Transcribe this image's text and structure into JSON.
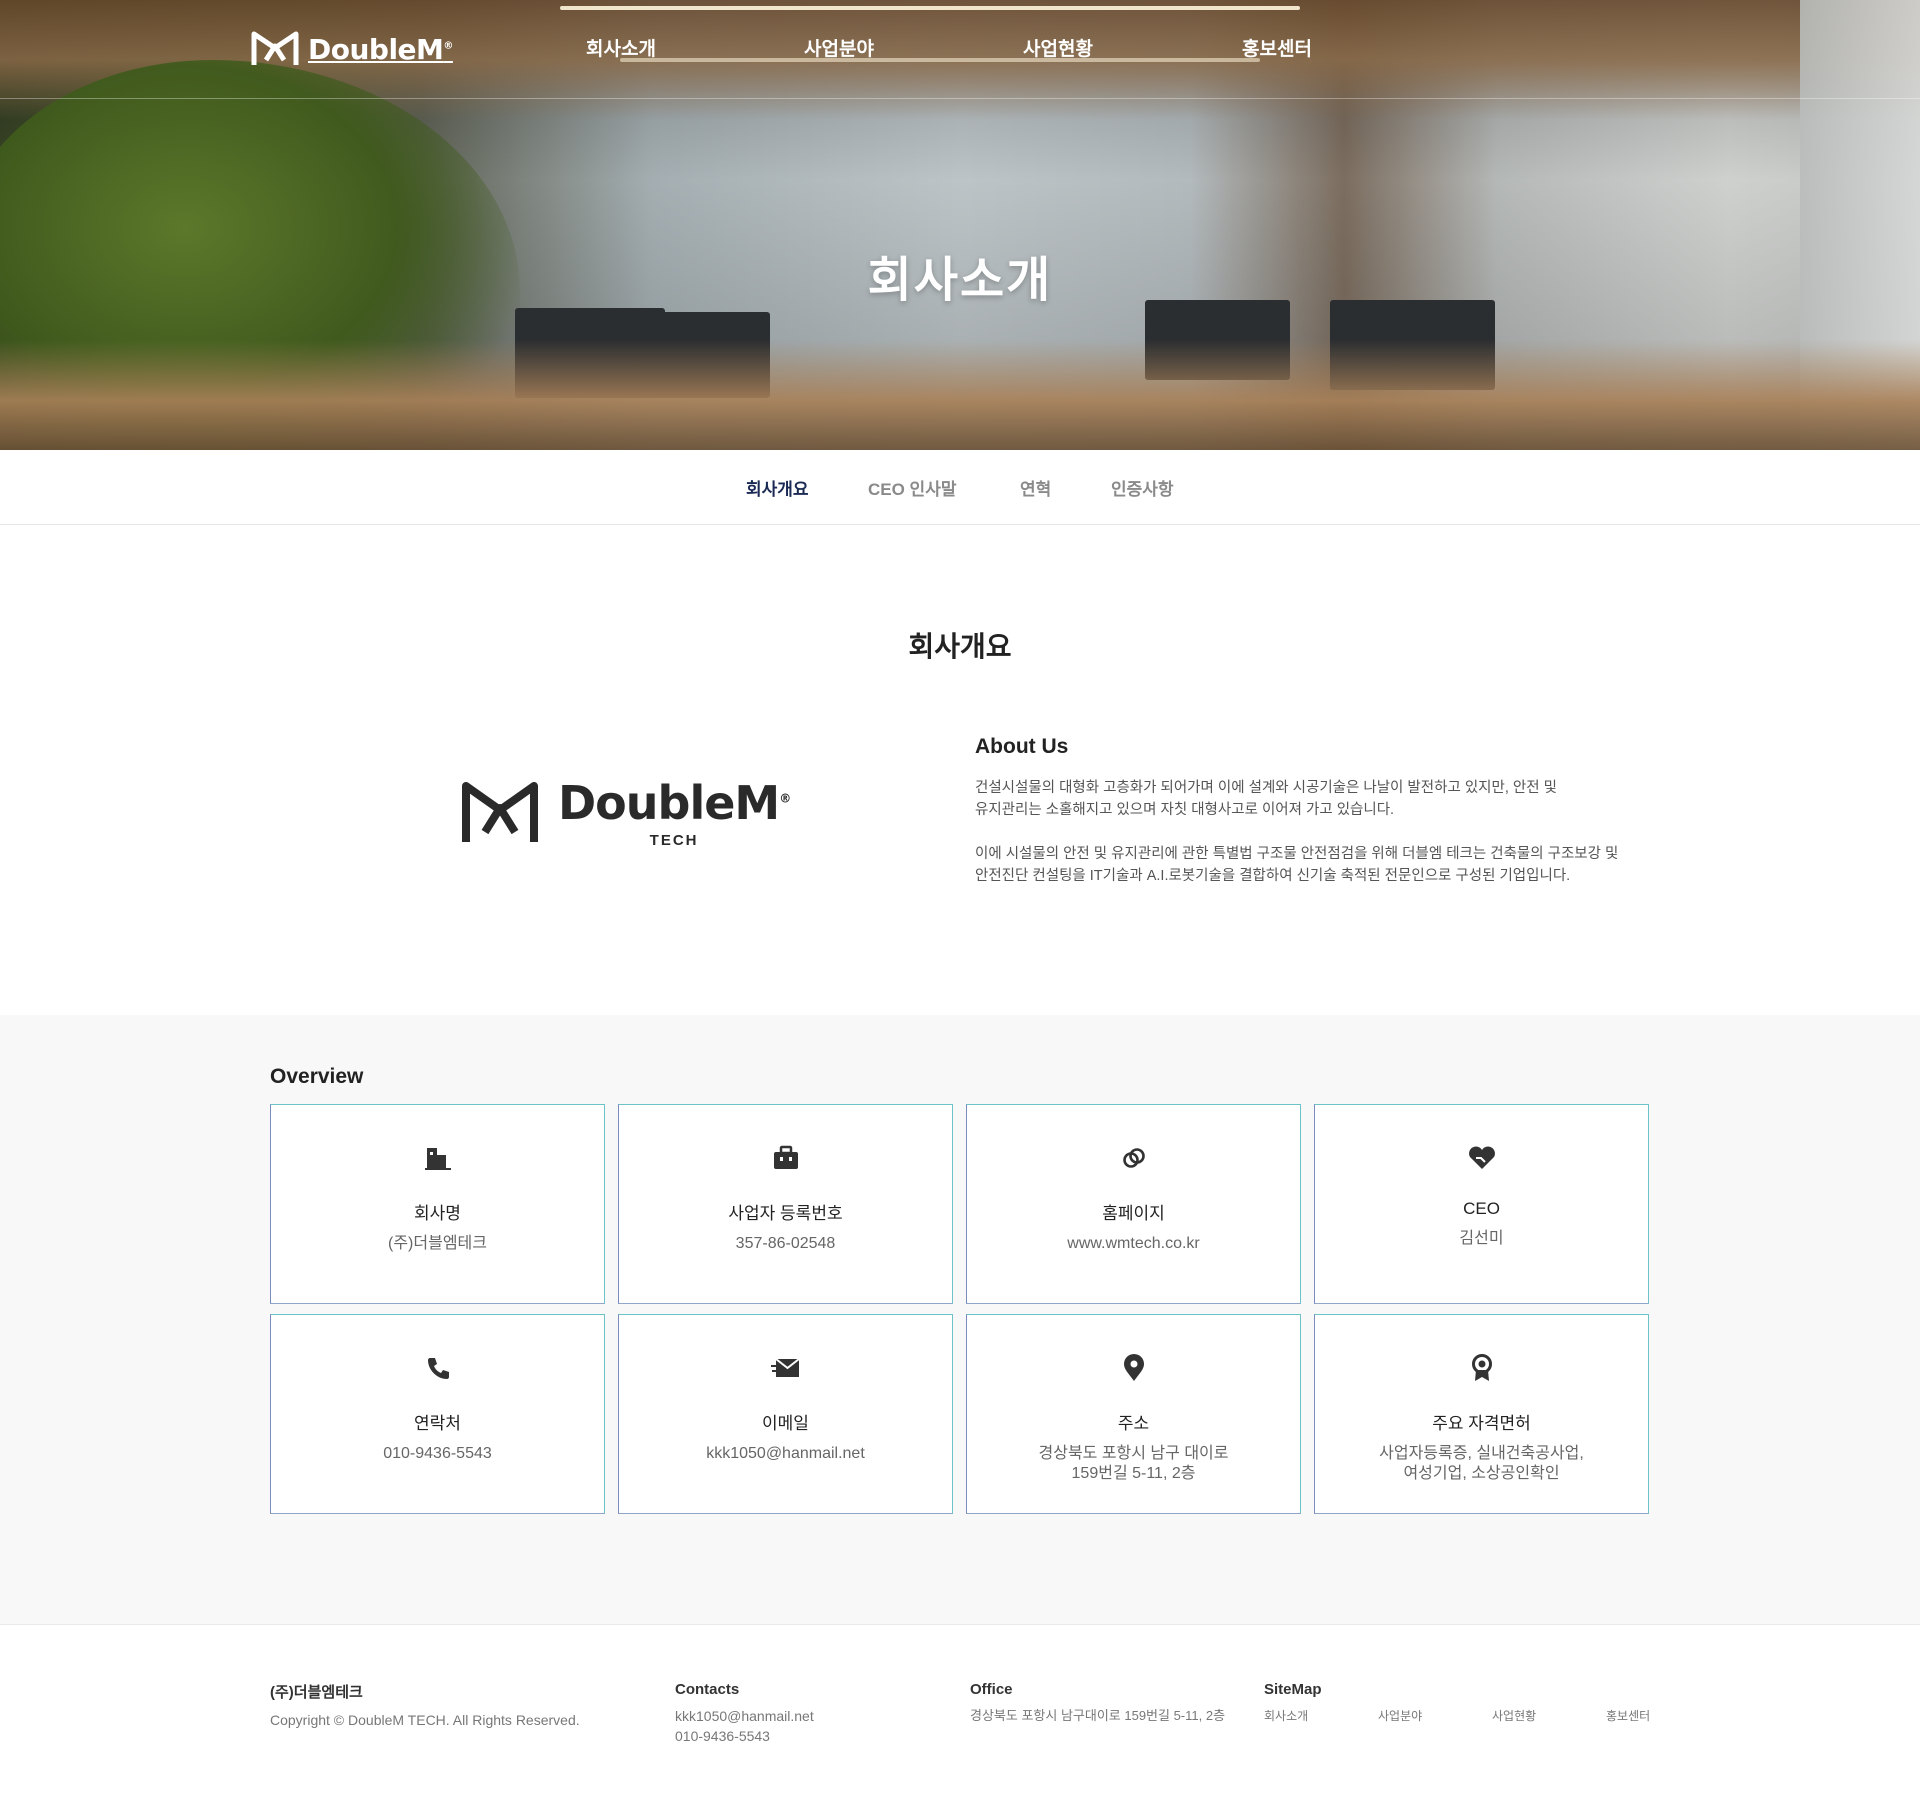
{
  "header": {
    "logo_text": "DoubleM",
    "logo_reg": "®",
    "menu": [
      "회사소개",
      "사업분야",
      "사업현황",
      "홍보센터"
    ]
  },
  "hero": {
    "title": "회사소개"
  },
  "subtabs": [
    "회사개요",
    "CEO 인사말",
    "연혁",
    "인증사항"
  ],
  "intro": {
    "title": "회사개요",
    "logo_word": "DoubleM",
    "logo_reg": "®",
    "logo_sub": "TECH",
    "about_heading": "About Us",
    "about_p1_line1": "건설시설물의 대형화 고층화가 되어가며 이에 설계와 시공기술은 나날이 발전하고 있지만, 안전 및",
    "about_p1_line2": "유지관리는 소홀해지고 있으며 자칫 대형사고로 이어져 가고 있습니다.",
    "about_p2_line1": "이에 시설물의 안전 및 유지관리에 관한 특별법 구조물 안전점검을 위해 더블엠 테크는 건축물의 구조보강 및",
    "about_p2_line2": "안전진단 컨설팅을 IT기술과 A.I.로봇기술을 결합하여 신기술 축적된 전문인으로 구성된 기업입니다."
  },
  "overview": {
    "title": "Overview",
    "cards": [
      {
        "icon": "building-icon",
        "label": "회사명",
        "value": "(주)더블엠테크",
        "value2": ""
      },
      {
        "icon": "briefcase-icon",
        "label": "사업자 등록번호",
        "value": "357-86-02548",
        "value2": ""
      },
      {
        "icon": "link-icon",
        "label": "홈페이지",
        "value": "www.wmtech.co.kr",
        "value2": ""
      },
      {
        "icon": "handshake-heart-icon",
        "label": "CEO",
        "value": "김선미",
        "value2": ""
      },
      {
        "icon": "phone-icon",
        "label": "연락처",
        "value": "010-9436-5543",
        "value2": ""
      },
      {
        "icon": "mail-send-icon",
        "label": "이메일",
        "value": "kkk1050@hanmail.net",
        "value2": ""
      },
      {
        "icon": "location-pin-icon",
        "label": "주소",
        "value": "경상북도 포항시 남구 대이로",
        "value2": "159번길 5-11, 2층"
      },
      {
        "icon": "award-icon",
        "label": "주요 자격면허",
        "value": "사업자등록증, 실내건축공사업,",
        "value2": "여성기업, 소상공인확인"
      }
    ]
  },
  "footer": {
    "company": "(주)더블엠테크",
    "copyright": "Copyright © DoubleM TECH. All Rights Reserved.",
    "contacts_heading": "Contacts",
    "email": "kkk1050@hanmail.net",
    "phone": "010-9436-5543",
    "office_heading": "Office",
    "office_address": "경상북도 포항시 남구대이로 159번길 5-11, 2층",
    "sitemap_heading": "SiteMap",
    "sitemap": [
      "회사소개",
      "사업분야",
      "사업현황",
      "홍보센터"
    ]
  },
  "colors": {
    "active_tab": "#1b2a55",
    "card_border": "#6ec3c8",
    "overview_bg": "#f8f8f8"
  }
}
